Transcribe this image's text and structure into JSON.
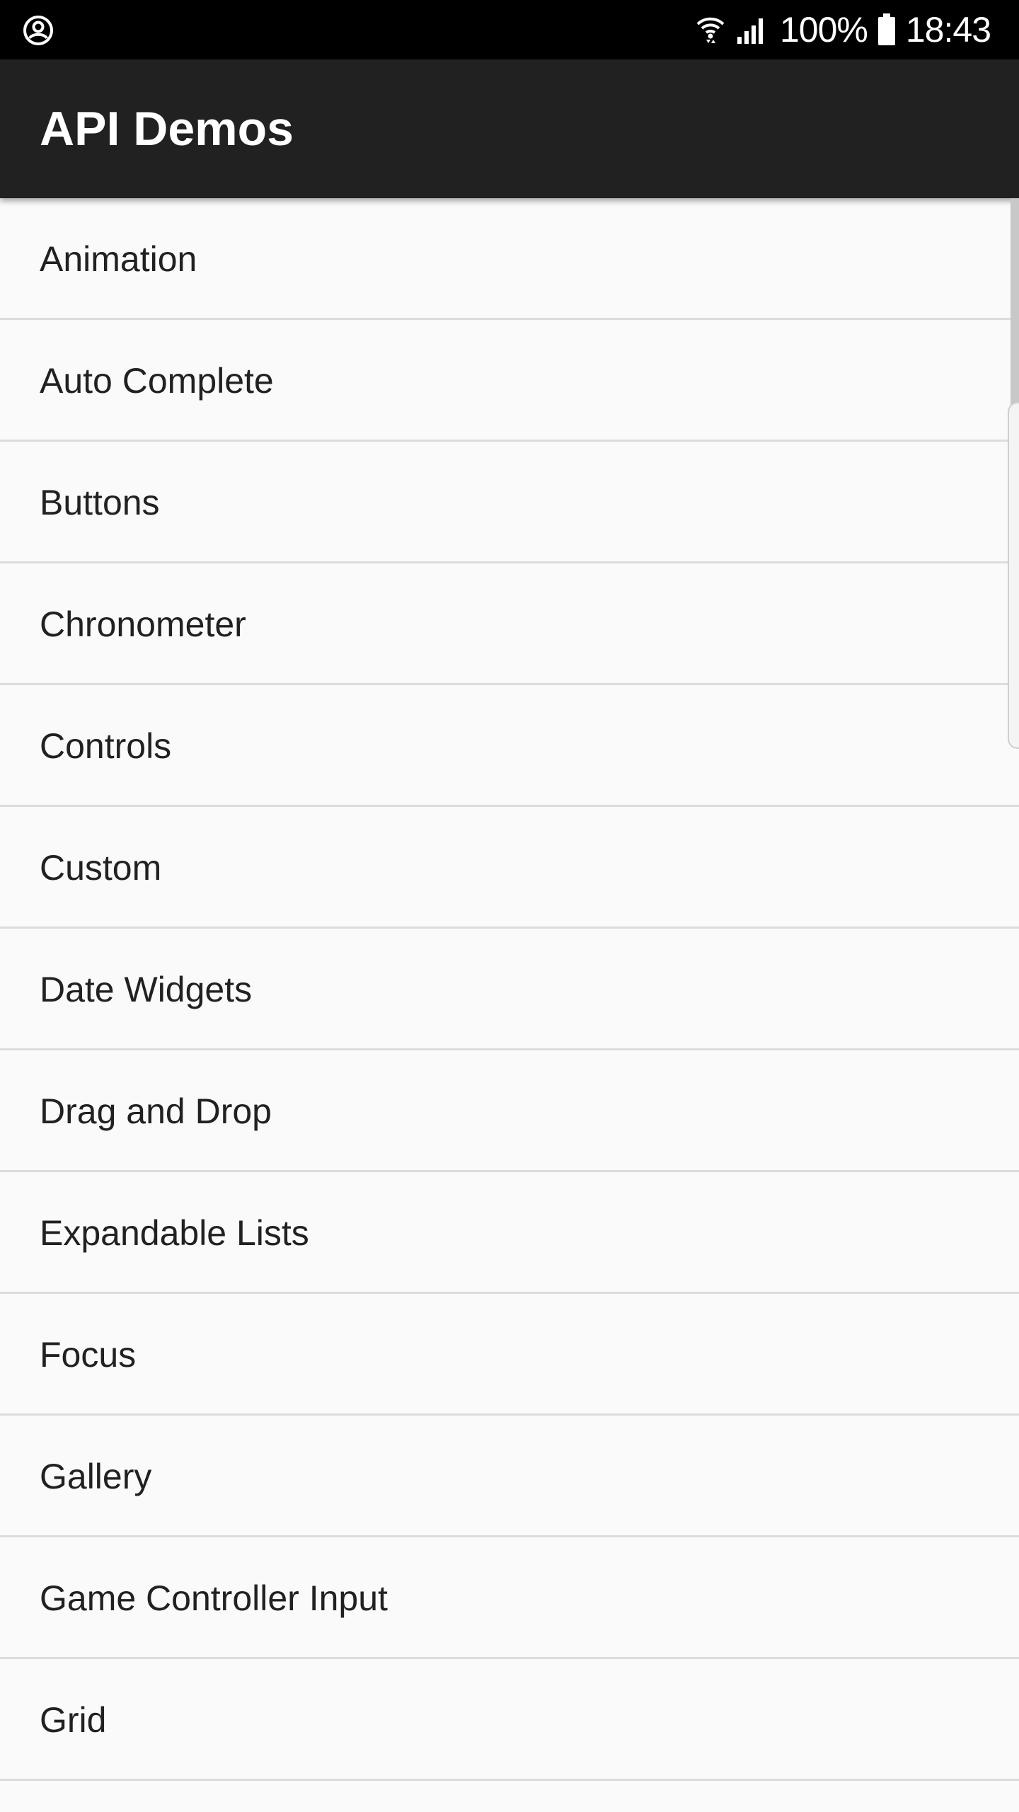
{
  "status_bar": {
    "left_icon": "account-circle-icon",
    "wifi_icon": "wifi-icon",
    "signal_icon": "cell-signal-icon",
    "battery_icon": "battery-full-icon",
    "battery_percent": "100%",
    "time": "18:43"
  },
  "app_bar": {
    "title": "API Demos",
    "background_color": "#212121"
  },
  "list": {
    "items": [
      {
        "label": "Animation"
      },
      {
        "label": "Auto Complete"
      },
      {
        "label": "Buttons"
      },
      {
        "label": "Chronometer"
      },
      {
        "label": "Controls"
      },
      {
        "label": "Custom"
      },
      {
        "label": "Date Widgets"
      },
      {
        "label": "Drag and Drop"
      },
      {
        "label": "Expandable Lists"
      },
      {
        "label": "Focus"
      },
      {
        "label": "Gallery"
      },
      {
        "label": "Game Controller Input"
      },
      {
        "label": "Grid"
      },
      {
        "label": ""
      }
    ]
  }
}
